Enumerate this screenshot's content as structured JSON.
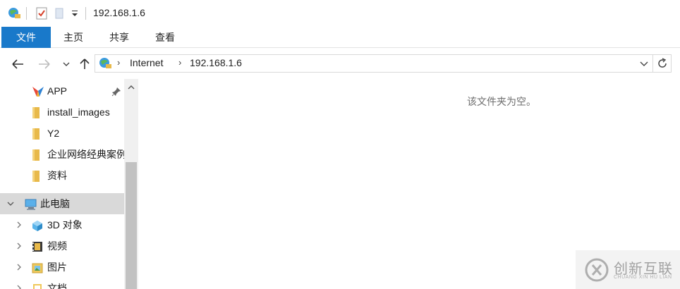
{
  "window": {
    "title": "192.168.1.6"
  },
  "ribbon": {
    "tabs": [
      "文件",
      "主页",
      "共享",
      "查看"
    ]
  },
  "address": {
    "crumbs": [
      "Internet",
      "192.168.1.6"
    ]
  },
  "nav": {
    "quick_access": [
      {
        "label": "APP",
        "icon": "app-icon",
        "pinned": true
      },
      {
        "label": "install_images",
        "icon": "folder-icon"
      },
      {
        "label": "Y2",
        "icon": "folder-icon"
      },
      {
        "label": "企业网络经典案例",
        "icon": "folder-icon"
      },
      {
        "label": "资料",
        "icon": "folder-icon"
      }
    ],
    "this_pc": {
      "label": "此电脑",
      "icon": "computer-icon"
    },
    "pc_children": [
      {
        "label": "3D 对象",
        "icon": "3d-objects-icon"
      },
      {
        "label": "视频",
        "icon": "video-icon"
      },
      {
        "label": "图片",
        "icon": "pictures-icon"
      },
      {
        "label": "文档",
        "icon": "documents-icon"
      }
    ]
  },
  "content": {
    "empty_message": "该文件夹为空。"
  },
  "watermark": {
    "text": "创新互联",
    "sub": "CHUANG XIN HU LIAN"
  },
  "colors": {
    "accent": "#1979ca",
    "selected": "#d9d9d9",
    "folder": "#e8b94a"
  }
}
